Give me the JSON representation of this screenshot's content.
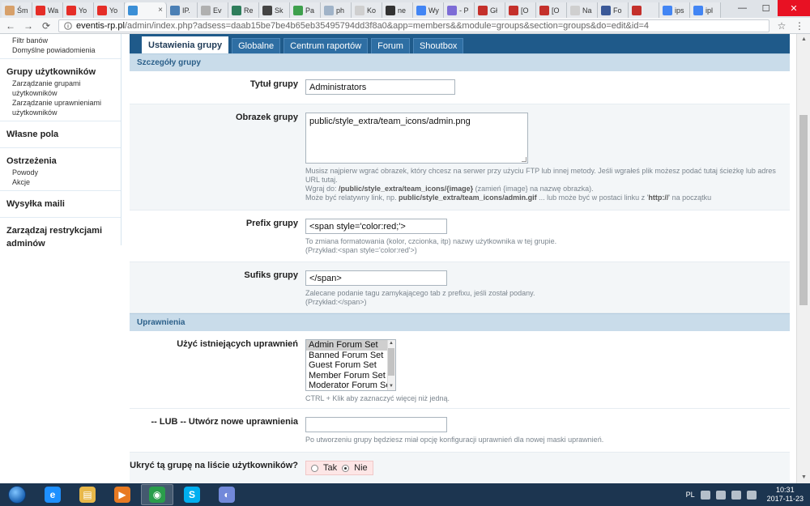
{
  "browser": {
    "tabs": [
      {
        "label": "Śm",
        "color": "#d7a06a"
      },
      {
        "label": "Wa",
        "color": "#e52d27"
      },
      {
        "label": "Yo",
        "color": "#e52d27"
      },
      {
        "label": "Yo",
        "color": "#e52d27"
      },
      {
        "label": "",
        "color": "#3b8fd6",
        "active": true,
        "close": "×"
      },
      {
        "label": "IP.",
        "color": "#4a7fb5"
      },
      {
        "label": "Ev",
        "color": "#b0b0b0"
      },
      {
        "label": "Re",
        "color": "#2e7d5b"
      },
      {
        "label": "Sk",
        "color": "#444444"
      },
      {
        "label": "Pa",
        "color": "#3ea04d"
      },
      {
        "label": "ph",
        "color": "#a0b3c8"
      },
      {
        "label": "Ko",
        "color": "#cfcfcf"
      },
      {
        "label": "ne",
        "color": "#333333"
      },
      {
        "label": "Wy",
        "color": "#4285f4"
      },
      {
        "label": "- P",
        "color": "#7d6cd6"
      },
      {
        "label": "Gł",
        "color": "#c4302b"
      },
      {
        "label": "[O",
        "color": "#c4302b"
      },
      {
        "label": "[O",
        "color": "#c4302b"
      },
      {
        "label": "Na",
        "color": "#cfcfcf"
      },
      {
        "label": "Fo",
        "color": "#3b5998"
      },
      {
        "label": "",
        "color": "#c4302b"
      },
      {
        "label": "ips",
        "color": "#4285f4"
      },
      {
        "label": "ipl",
        "color": "#4285f4"
      }
    ],
    "window_controls": {
      "minimize": "—",
      "maximize": "☐",
      "close": "✕"
    },
    "nav": {
      "back": "←",
      "forward": "→",
      "reload": "⟳"
    },
    "url_host": "eventis-rp.pl",
    "url_path": "/admin/index.php?adsess=daab15be7be4b65eb35495794dd3f8a0&app=members&&module=groups&section=groups&do=edit&id=4",
    "star": "☆",
    "menu": "⋮"
  },
  "sidebar": {
    "blocks": [
      {
        "heading": "",
        "items": [
          "Filtr banów",
          "Domyślne powiadomienia"
        ]
      },
      {
        "heading": "Grupy użytkowników",
        "items": [
          "Zarządzanie grupami użytkowników",
          "Zarządzanie uprawnieniami",
          "użytkowników"
        ]
      },
      {
        "heading": "Własne pola",
        "items": []
      },
      {
        "heading": "Ostrzeżenia",
        "items": [
          "Powody",
          "Akcje"
        ]
      },
      {
        "heading": "Wysyłka maili",
        "items": []
      },
      {
        "heading": "Zarządzaj restrykcjami",
        "items": []
      },
      {
        "heading": "adminów",
        "items": []
      }
    ]
  },
  "main": {
    "tabs": [
      "Ustawienia grupy",
      "Globalne",
      "Centrum raportów",
      "Forum",
      "Shoutbox"
    ],
    "section1": "Szczegóły grupy",
    "title_label": "Tytuł grupy",
    "title_value": "Administrators",
    "image_label": "Obrazek grupy",
    "image_value": "public/style_extra/team_icons/admin.png",
    "image_help_1": "Musisz najpierw wgrać obrazek, który chcesz na serwer przy użyciu FTP lub innej metody. Jeśli wgrałeś plik możesz podać tutaj ścieżkę lub adres URL tutaj.",
    "image_help_2a": "Wgraj do: ",
    "image_help_2b": "/public/style_extra/team_icons/{image}",
    "image_help_2c": " (zamień {image} na nazwę obrazka).",
    "image_help_3a": "Może być relatywny link, np. ",
    "image_help_3b": "public/style_extra/team_icons/admin.gif",
    "image_help_3c": " ... lub może być w postaci linku z '",
    "image_help_3d": "http://",
    "image_help_3e": "' na początku",
    "prefix_label": "Prefix grupy",
    "prefix_value": "<span style='color:red;'>",
    "prefix_help_1": "To zmiana formatowania (kolor, czcionka, itp) nazwy użytkownika w tej grupie.",
    "prefix_help_2": "(Przykład:<span style='color:red'>)",
    "suffix_label": "Sufiks grupy",
    "suffix_value": "</span>",
    "suffix_help_1": "Zalecane podanie tagu zamykającego tab z prefixu, jeśli został podany.",
    "suffix_help_2": "(Przykład:</span>)",
    "section2": "Uprawnienia",
    "perm_label": "Użyć istniejących uprawnień",
    "perm_options": [
      "Admin Forum Set",
      "Banned Forum Set",
      "Guest Forum Set",
      "Member Forum Set",
      "Moderator Forum Set"
    ],
    "perm_help": "CTRL + Klik aby zaznaczyć więcej niż jedną.",
    "new_perm_label": "-- LUB -- Utwórz nowe uprawnienia",
    "new_perm_value": "",
    "new_perm_help": "Po utworzeniu grupy będziesz miał opcję konfiguracji uprawnień dla nowej maski uprawnień.",
    "hide_label": "Ukryć tą grupę na liście użytkowników?",
    "yes": "Tak",
    "no": "Nie"
  },
  "taskbar": {
    "apps": [
      {
        "name": "ie",
        "glyph": "e",
        "color": "#1e90ff"
      },
      {
        "name": "explorer",
        "glyph": "▤",
        "color": "#e8b84a"
      },
      {
        "name": "media",
        "glyph": "▶",
        "color": "#e87a22"
      },
      {
        "name": "chrome",
        "glyph": "◉",
        "color": "#2a9d4b",
        "active": true
      },
      {
        "name": "skype",
        "glyph": "S",
        "color": "#00aff0"
      },
      {
        "name": "discord",
        "glyph": "◐",
        "color": "#7289da"
      }
    ],
    "lang": "PL",
    "time": "10:31",
    "date": "2017-11-23"
  }
}
